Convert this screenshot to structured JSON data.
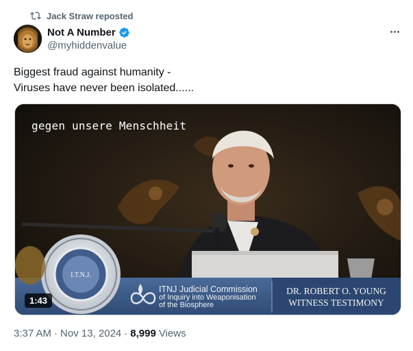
{
  "repost": {
    "text": "Jack Straw reposted",
    "icon": "repost-icon"
  },
  "author": {
    "display_name": "Not A Number",
    "handle": "@myhiddenvalue",
    "verified": true,
    "avatar_icon": "lion-avatar"
  },
  "tweet": {
    "lines": [
      "Biggest fraud against humanity -",
      "Viruses have never been isolated......"
    ]
  },
  "media": {
    "subtitle": "gegen unsere Menschheit",
    "duration": "1:43",
    "banner_left": {
      "line1": "ITNJ Judicial Commission",
      "line2": "of Inquiry into Weaponisation",
      "line3": "of the Biosphere"
    },
    "banner_right": {
      "line1": "DR. ROBERT O. YOUNG",
      "line2": "WITNESS TESTIMONY"
    },
    "seal_text": "I.T.N.J."
  },
  "meta": {
    "time": "3:37 AM",
    "separator": "·",
    "date": "Nov 13, 2024",
    "views_count": "8,999",
    "views_label": "Views"
  },
  "colors": {
    "secondary_text": "#536471",
    "verified_blue": "#1d9bf0",
    "primary_text": "#0f1419",
    "banner_blue": "#3d5a86"
  }
}
